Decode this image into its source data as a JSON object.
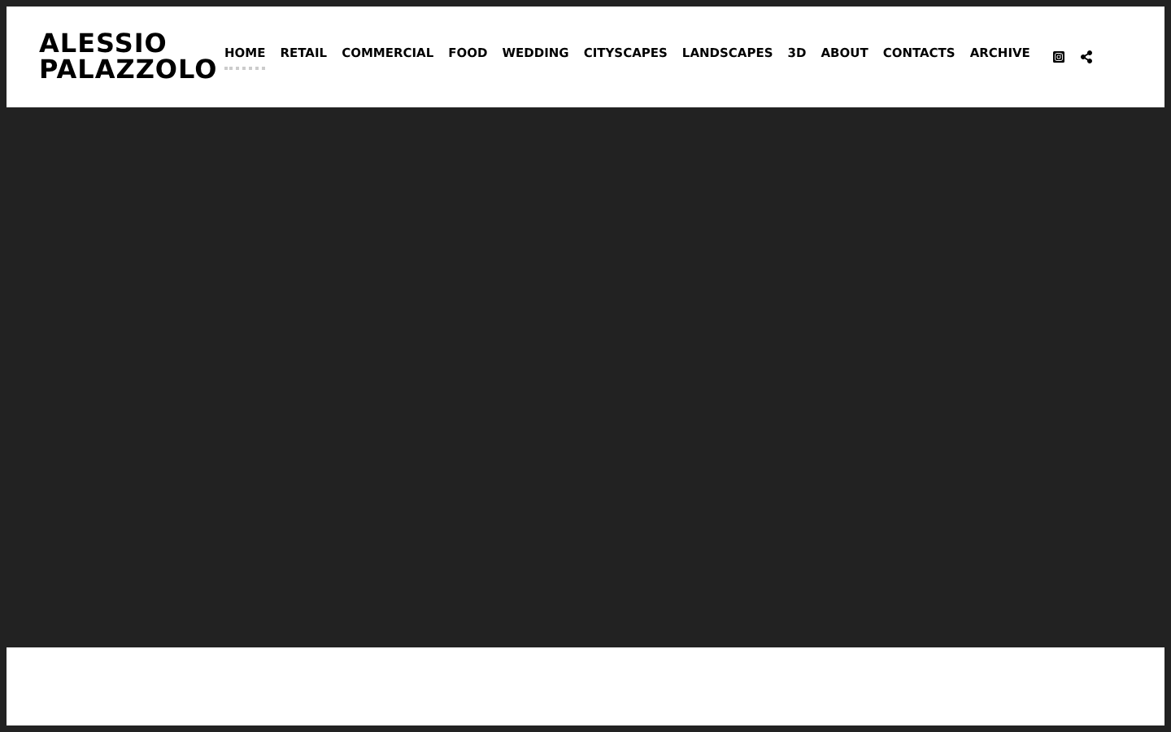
{
  "logo": "ALESSIO PALAZZOLO",
  "nav": [
    {
      "label": "HOME",
      "selected": true
    },
    {
      "label": "RETAIL",
      "selected": false
    },
    {
      "label": "COMMERCIAL",
      "selected": false
    },
    {
      "label": "FOOD",
      "selected": false
    },
    {
      "label": "WEDDING",
      "selected": false
    },
    {
      "label": "CITYSCAPES",
      "selected": false
    },
    {
      "label": "LANDSCAPES",
      "selected": false
    },
    {
      "label": "3D",
      "selected": false
    },
    {
      "label": "ABOUT",
      "selected": false
    },
    {
      "label": "CONTACTS",
      "selected": false
    },
    {
      "label": "ARCHIVE",
      "selected": false
    }
  ]
}
